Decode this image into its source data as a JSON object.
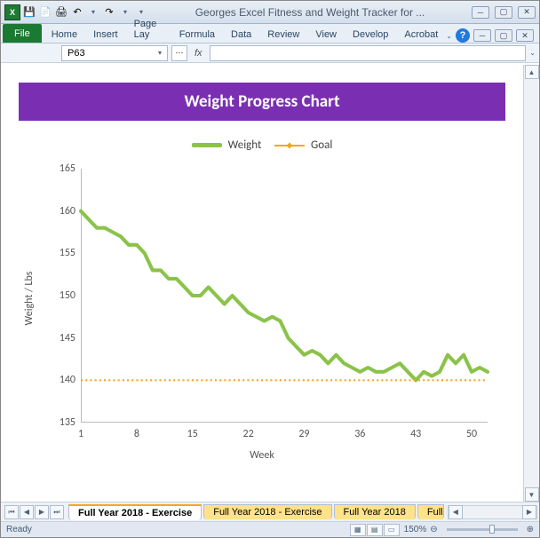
{
  "titlebar": {
    "title": "Georges Excel Fitness and Weight Tracker for ..."
  },
  "ribbon": {
    "file": "File",
    "tabs": [
      "Home",
      "Insert",
      "Page Lay",
      "Formula",
      "Data",
      "Review",
      "View",
      "Develop",
      "Acrobat"
    ]
  },
  "namebox": {
    "cell": "P63",
    "fx": "fx"
  },
  "chart_title": "Weight Progress Chart",
  "legend": {
    "weight": "Weight",
    "goal": "Goal"
  },
  "axes": {
    "ylabel": "Weight / Lbs",
    "xlabel": "Week"
  },
  "chart_data": {
    "type": "line",
    "x": [
      1,
      2,
      3,
      4,
      5,
      6,
      7,
      8,
      9,
      10,
      11,
      12,
      13,
      14,
      15,
      16,
      17,
      18,
      19,
      20,
      21,
      22,
      23,
      24,
      25,
      26,
      27,
      28,
      29,
      30,
      31,
      32,
      33,
      34,
      35,
      36,
      37,
      38,
      39,
      40,
      41,
      42,
      43,
      44,
      45,
      46,
      47,
      48,
      49,
      50,
      51,
      52
    ],
    "series": [
      {
        "name": "Weight",
        "values": [
          160,
          159,
          158,
          158,
          157.5,
          157,
          156,
          156,
          155,
          153,
          153,
          152,
          152,
          151,
          150,
          150,
          151,
          150,
          149,
          150,
          149,
          148,
          147.5,
          147,
          147.5,
          147,
          145,
          144,
          143,
          143.5,
          143,
          142,
          143,
          142,
          141.5,
          141,
          141.5,
          141,
          141,
          141.5,
          142,
          141,
          140,
          141,
          140.5,
          141,
          143,
          142,
          143,
          141,
          141.5,
          141
        ]
      },
      {
        "name": "Goal",
        "values": [
          140,
          140,
          140,
          140,
          140,
          140,
          140,
          140,
          140,
          140,
          140,
          140,
          140,
          140,
          140,
          140,
          140,
          140,
          140,
          140,
          140,
          140,
          140,
          140,
          140,
          140,
          140,
          140,
          140,
          140,
          140,
          140,
          140,
          140,
          140,
          140,
          140,
          140,
          140,
          140,
          140,
          140,
          140,
          140,
          140,
          140,
          140,
          140,
          140,
          140,
          140,
          140
        ]
      }
    ],
    "xlabel": "Week",
    "ylabel": "Weight / Lbs",
    "ylim": [
      135,
      165
    ],
    "y_ticks": [
      135,
      140,
      145,
      150,
      155,
      160,
      165
    ],
    "x_ticks": [
      1,
      8,
      15,
      22,
      29,
      36,
      43,
      50
    ]
  },
  "sheets": {
    "active": "Full Year 2018 - Exercise",
    "others": [
      "Full Year 2018 - Exercise",
      "Full Year 2018",
      "Full"
    ]
  },
  "status": {
    "ready": "Ready",
    "zoom": "150%"
  }
}
